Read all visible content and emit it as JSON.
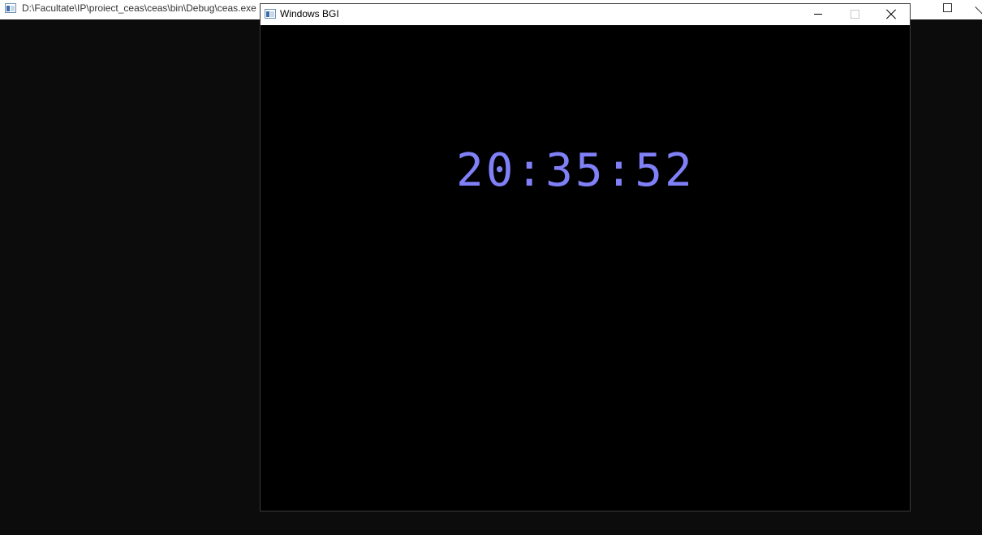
{
  "console": {
    "title": "D:\\Facultate\\IP\\proiect_ceas\\ceas\\bin\\Debug\\ceas.exe"
  },
  "bgi": {
    "title": "Windows BGI",
    "clock": {
      "time": "20:35:52",
      "color": "#8080f8"
    },
    "background": "#000000"
  },
  "icons": {
    "app": "app-window-icon",
    "minimize": "minimize-icon",
    "maximize": "maximize-icon",
    "close": "close-icon"
  }
}
